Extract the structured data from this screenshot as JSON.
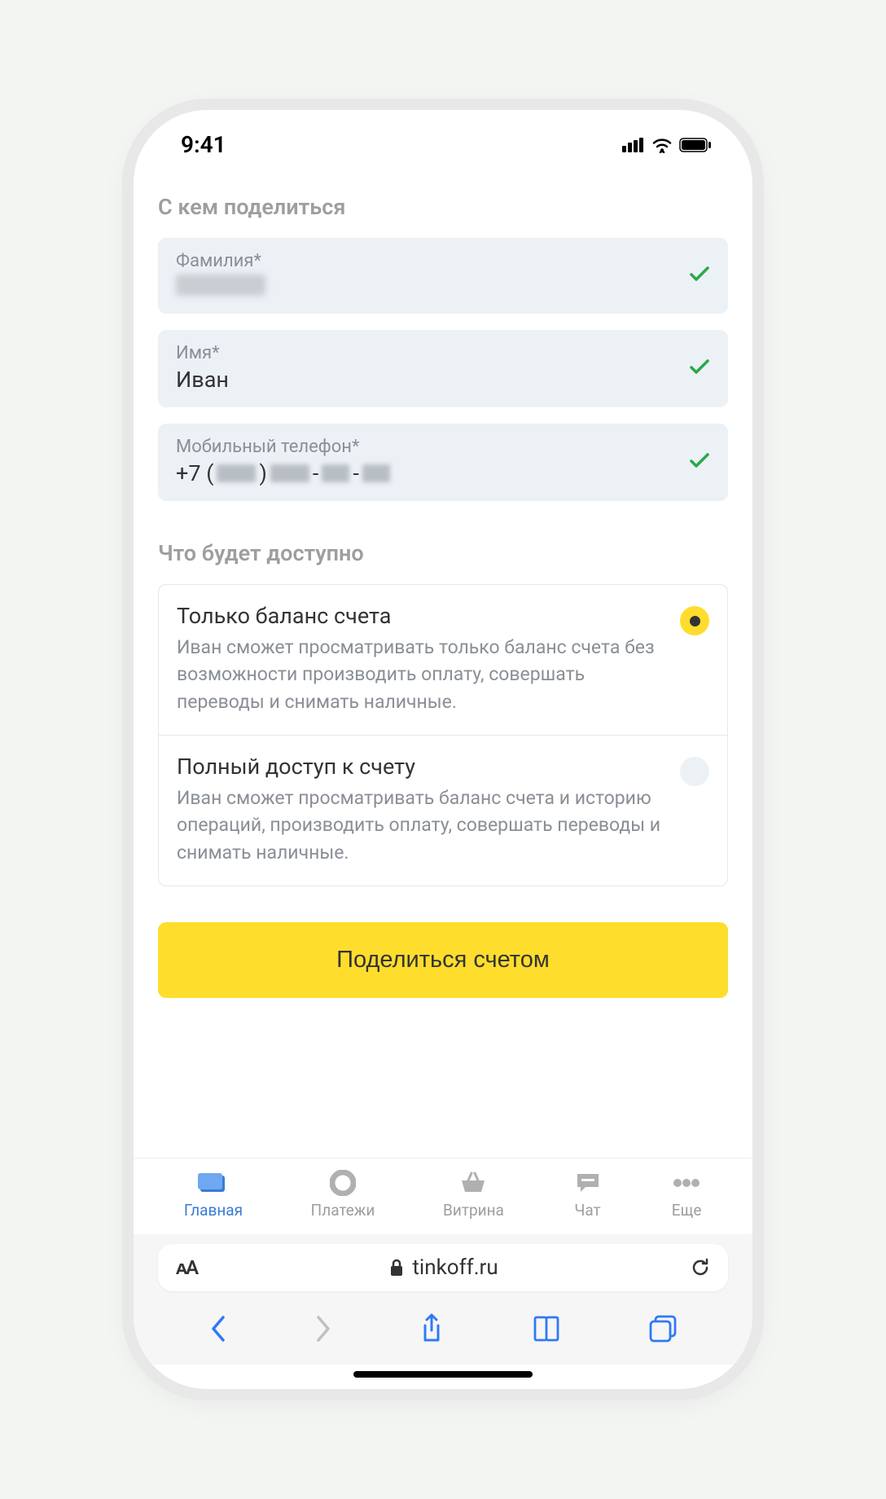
{
  "status": {
    "time": "9:41"
  },
  "sections": {
    "share_with": "С кем поделиться",
    "access": "Что будет доступно"
  },
  "fields": {
    "surname": {
      "label": "Фамилия*",
      "value_redacted": true
    },
    "name": {
      "label": "Имя*",
      "value": "Иван"
    },
    "phone": {
      "label": "Мобильный телефон*",
      "prefix": "+7 (",
      "mid": ") ",
      "dash": "-",
      "value_redacted": true
    }
  },
  "options": {
    "balance": {
      "title": "Только баланс счета",
      "desc": "Иван сможет просматривать только баланс счета без возможности производить оплату, совершать переводы и снимать наличные.",
      "selected": true
    },
    "full": {
      "title": "Полный доступ к счету",
      "desc": "Иван сможет просматривать баланс счета и историю операций, производить оплату, совершать переводы и снимать наличные.",
      "selected": false
    }
  },
  "cta": {
    "share": "Поделиться счетом"
  },
  "tabs": {
    "home": "Главная",
    "payments": "Платежи",
    "showcase": "Витрина",
    "chat": "Чат",
    "more": "Еще"
  },
  "safari": {
    "url": "tinkoff.ru"
  }
}
